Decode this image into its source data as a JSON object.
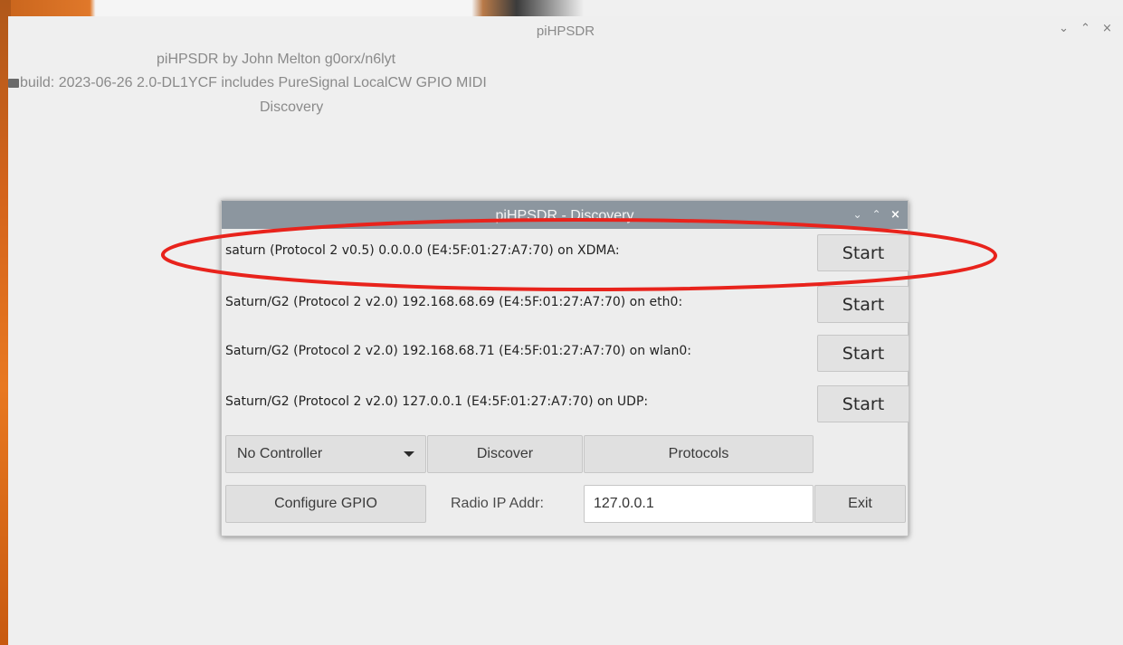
{
  "main_window": {
    "title": "piHPSDR",
    "author": "piHPSDR by John Melton g0orx/n6lyt",
    "build": "build: 2023-06-26 2.0-DL1YCF includes PureSignal LocalCW GPIO MIDI",
    "status": "Discovery",
    "controls": {
      "minimize": "⌄",
      "maximize": "⌃",
      "close": "×"
    }
  },
  "dialog": {
    "title": "piHPSDR - Discovery",
    "controls": {
      "minimize": "⌄",
      "maximize": "⌃",
      "close": "×"
    },
    "radios": [
      {
        "label": "saturn (Protocol 2 v0.5) 0.0.0.0 (E4:5F:01:27:A7:70) on XDMA:",
        "button": "Start"
      },
      {
        "label": "Saturn/G2 (Protocol 2 v2.0) 192.168.68.69 (E4:5F:01:27:A7:70) on eth0:",
        "button": "Start"
      },
      {
        "label": "Saturn/G2 (Protocol 2 v2.0) 192.168.68.71 (E4:5F:01:27:A7:70) on wlan0:",
        "button": "Start"
      },
      {
        "label": "Saturn/G2 (Protocol 2 v2.0) 127.0.0.1 (E4:5F:01:27:A7:70) on UDP:",
        "button": "Start"
      }
    ],
    "controller_select": "No Controller",
    "discover_label": "Discover",
    "protocols_label": "Protocols",
    "configure_gpio_label": "Configure GPIO",
    "radio_ip_label": "Radio IP Addr:",
    "radio_ip_value": "127.0.0.1",
    "exit_label": "Exit"
  },
  "colors": {
    "annotation": "#e8231c",
    "titlebar": "#8c969f"
  }
}
